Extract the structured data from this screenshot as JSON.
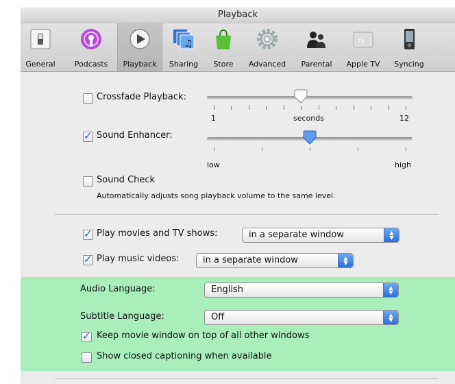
{
  "window": {
    "title": "Playback"
  },
  "toolbar": {
    "items": [
      {
        "label": "General",
        "icon": "switch-icon"
      },
      {
        "label": "Podcasts",
        "icon": "podcast-icon"
      },
      {
        "label": "Playback",
        "icon": "play-icon",
        "selected": true
      },
      {
        "label": "Sharing",
        "icon": "sharing-icon"
      },
      {
        "label": "Store",
        "icon": "shopping-bag-icon"
      },
      {
        "label": "Advanced",
        "icon": "gear-icon"
      },
      {
        "label": "Parental",
        "icon": "people-icon"
      },
      {
        "label": "Apple TV",
        "icon": "apple-tv-icon"
      },
      {
        "label": "Syncing",
        "icon": "ipod-icon"
      }
    ]
  },
  "crossfade": {
    "label": "Crossfade Playback:",
    "checked": false,
    "min_label": "1",
    "unit_label": "seconds",
    "max_label": "12",
    "value": 6
  },
  "enhancer": {
    "label": "Sound Enhancer:",
    "checked": true,
    "low_label": "low",
    "high_label": "high",
    "level": 0.5
  },
  "soundcheck": {
    "label": "Sound Check",
    "checked": false,
    "description": "Automatically adjusts song playback volume to the same level."
  },
  "movies": {
    "label": "Play movies and TV shows:",
    "checked": true,
    "value": "in a separate window"
  },
  "videos": {
    "label": "Play music videos:",
    "checked": true,
    "value": "in a separate window"
  },
  "audio_language": {
    "label": "Audio Language:",
    "value": "English"
  },
  "subtitle_language": {
    "label": "Subtitle Language:",
    "value": "Off"
  },
  "on_top": {
    "label": "Keep movie window on top of all other windows",
    "checked": true
  },
  "captioning": {
    "label": "Show closed captioning when available",
    "checked": false
  },
  "colors": {
    "highlight": "#a8efbc",
    "accent": "#2a6ed8"
  }
}
